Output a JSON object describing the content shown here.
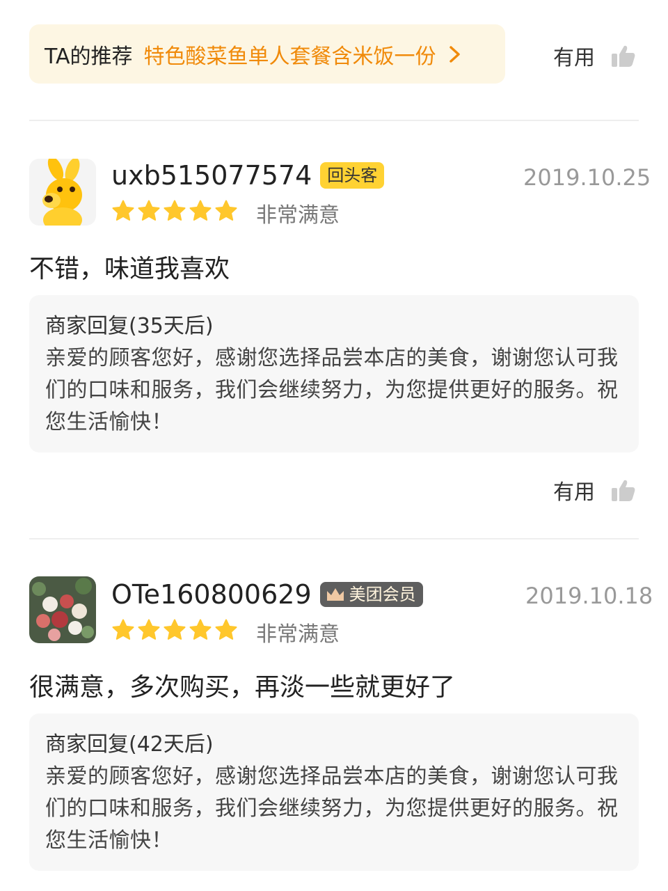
{
  "recommendation": {
    "prefix": "TA的推荐",
    "dish": "特色酸菜鱼单人套餐含米饭一份"
  },
  "useful_label": "有用",
  "reviews": [
    {
      "username": "uxb515077574",
      "badge": "回头客",
      "date": "2019.10.25",
      "rating": 5,
      "rating_text": "非常满意",
      "comment": "不错，味道我喜欢",
      "reply_title": "商家回复(35天后)",
      "reply_text": "亲爱的顾客您好，感谢您选择品尝本店的美食，谢谢您认可我们的口味和服务，我们会继续努力，为您提供更好的服务。祝您生活愉快！"
    },
    {
      "username": "OTe160800629",
      "badge": "美团会员",
      "date": "2019.10.18",
      "rating": 5,
      "rating_text": "非常满意",
      "comment": "很满意，多次购买，再淡一些就更好了",
      "reply_title": "商家回复(42天后)",
      "reply_text": "亲爱的顾客您好，感谢您选择品尝本店的美食，谢谢您认可我们的口味和服务，我们会继续努力，为您提供更好的服务。祝您生活愉快！"
    }
  ],
  "colors": {
    "accent_orange": "#f08a0a",
    "star_yellow": "#ffc72c",
    "return_badge": "#ffd233",
    "member_badge": "#5e5e5e"
  }
}
